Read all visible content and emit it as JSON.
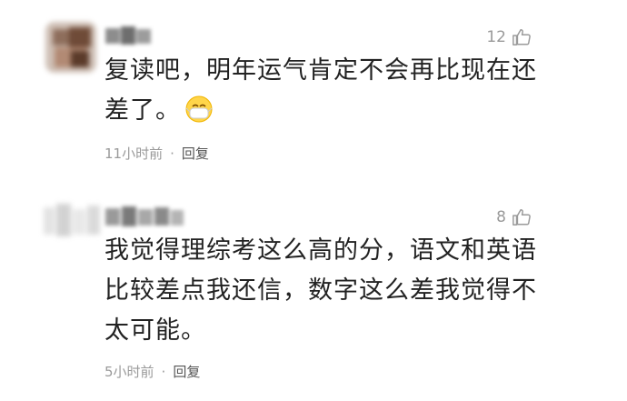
{
  "comments": [
    {
      "likes": "12",
      "text_line1": "复读吧，明年运气肯定不会再比现在还",
      "text_line2": "差了。",
      "emoji": "masked-face-emoji",
      "time": "11小时前",
      "separator": "·",
      "reply": "回复"
    },
    {
      "likes": "8",
      "text_line1": "我觉得理综考这么高的分，语文和英语",
      "text_line2": "比较差点我还信，数字这么差我觉得不",
      "text_line3": "太可能。",
      "time": "5小时前",
      "separator": "·",
      "reply": "回复"
    }
  ],
  "colors": {
    "text": "#222222",
    "meta": "#9a9a9a",
    "reply": "#555555",
    "background": "#ffffff"
  },
  "icons": [
    "thumbs-up-icon",
    "masked-face-emoji"
  ]
}
